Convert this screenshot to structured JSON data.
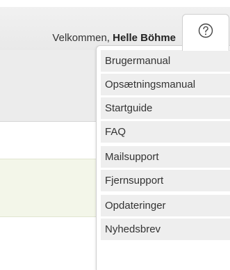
{
  "header": {
    "welcome_text": "Velkommen,",
    "user_name": "Helle Böhme"
  },
  "help": {
    "icon": "help-circle-icon",
    "menu_groups": [
      [
        {
          "label": "Brugermanual"
        },
        {
          "label": "Opsætningsmanual"
        },
        {
          "label": "Startguide"
        },
        {
          "label": "FAQ"
        }
      ],
      [
        {
          "label": "Mailsupport"
        },
        {
          "label": "Fjernsupport"
        }
      ],
      [
        {
          "label": "Opdateringer"
        },
        {
          "label": "Nyhedsbrev"
        }
      ]
    ]
  },
  "colors": {
    "header_bg": "#ececec",
    "menu_item_bg": "#eeeeee",
    "panel_green": "#f3f6e9",
    "text": "#333333"
  }
}
